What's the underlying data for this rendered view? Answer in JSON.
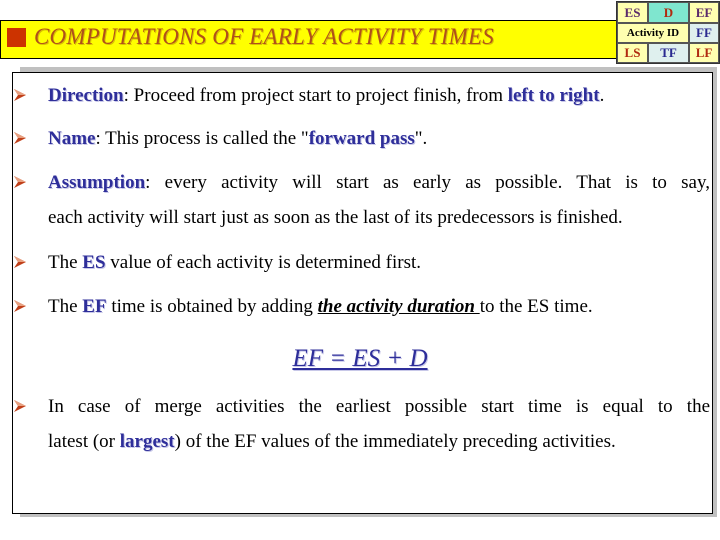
{
  "title": "COMPUTATIONS OF EARLY ACTIVITY TIMES",
  "node_legend": {
    "row1": [
      "ES",
      "D",
      "EF"
    ],
    "row2": [
      "Activity ID",
      "FF"
    ],
    "row3": [
      "LS",
      "TF",
      "LF"
    ]
  },
  "bullets": [
    {
      "keyword": "Direction",
      "text": ": Proceed from project start to project finish, from ",
      "keyword2": "left to right",
      "tail": "."
    },
    {
      "keyword": "Name",
      "text": ": This process is called the \"",
      "keyword2": "forward pass",
      "tail": "\"."
    },
    {
      "keyword": "Assumption",
      "text": ": every activity will start as early as possible. That is to say,",
      "line2": "each activity will start just as soon as the last of its predecessors is finished."
    },
    {
      "prefix": "The ",
      "keyword": "ES",
      "text": " value of each activity is determined first."
    },
    {
      "prefix": "The ",
      "keyword": "EF",
      "text": " time is obtained by adding ",
      "emph": "the activity duration ",
      "tail": "to the ES time."
    },
    {
      "line1": "In case of merge activities the earliest possible start time is equal to the",
      "line2_prefix": "latest (or ",
      "keyword": "largest",
      "line2_tail": ") of the EF values of the immediately preceding activities."
    }
  ],
  "formula": "EF = ES + D",
  "colors": {
    "title_bg": "#ffff00",
    "title_text": "#b0501a",
    "accent_square": "#cc3300",
    "keyword": "#2e2e9a",
    "bullet_arrow": "#c0401a"
  }
}
